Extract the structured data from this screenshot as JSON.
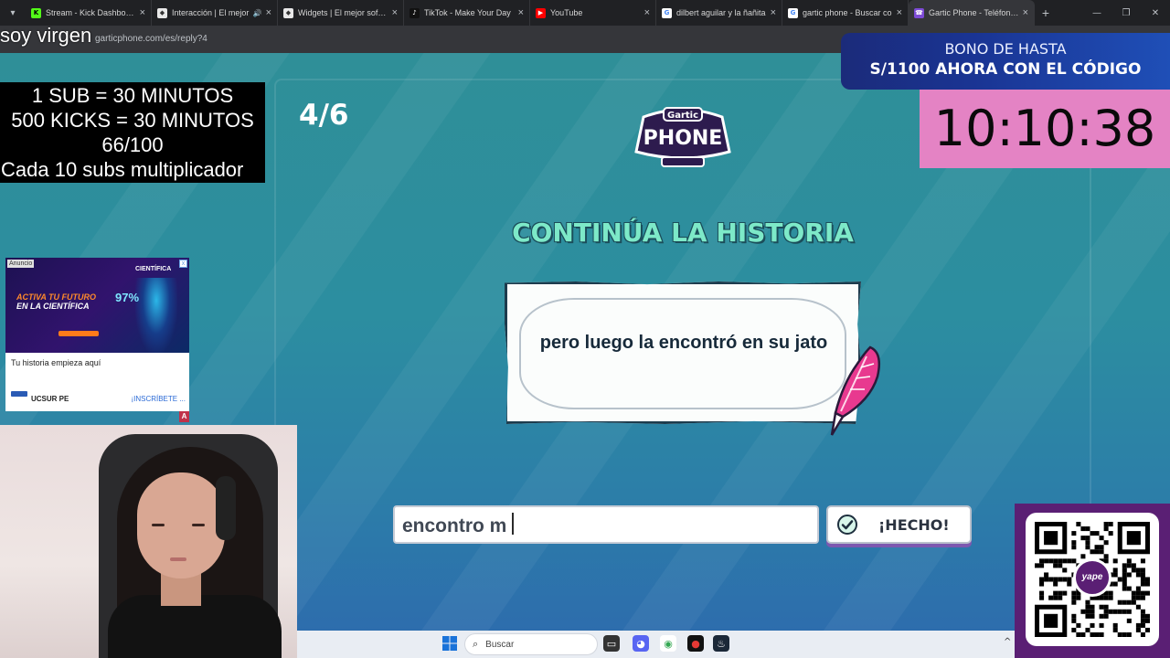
{
  "browser": {
    "tabs": [
      {
        "label": "Stream - Kick Dashboard",
        "icon": "kick-icon",
        "color": "#53fc18"
      },
      {
        "label": "Interacción | El mejor",
        "icon": "streamelements-icon",
        "color": "#e8e8e8"
      },
      {
        "label": "Widgets | El mejor softwa",
        "icon": "streamelements-icon",
        "color": "#e8e8e8"
      },
      {
        "label": "TikTok - Make Your Day",
        "icon": "tiktok-icon",
        "color": "#111111"
      },
      {
        "label": "YouTube",
        "icon": "youtube-icon",
        "color": "#ff0000"
      },
      {
        "label": "dilbert aguilar y la ñañita",
        "icon": "google-icon",
        "color": "#4285f4"
      },
      {
        "label": "gartic phone - Buscar co",
        "icon": "google-icon",
        "color": "#4285f4"
      },
      {
        "label": "Gartic Phone - Teléfono D",
        "icon": "gartic-icon",
        "color": "#7d4bd6"
      }
    ],
    "url": "garticphone.com/es/reply?4"
  },
  "stream_overlay": {
    "streamer_name": "soy virgen",
    "sub_rules": [
      "1 SUB     = 30 MINUTOS",
      "500 KICKS = 30 MINUTOS",
      "66/100",
      "Cada 10 subs multiplicador"
    ],
    "promo_line1": "BONO DE HASTA",
    "promo_line2": "S/1100 AHORA CON EL CÓDIGO",
    "timer": "10:10:38"
  },
  "ad": {
    "badge": "Anuncio",
    "brand": "CIENTÍFICA",
    "headline1": "ACTIVA TU FUTURO",
    "headline2": "EN LA CIENTÍFICA",
    "percent": "97%",
    "title": "Tu historia empieza aquí",
    "advertiser": "UCSUR PE",
    "cta": "¡INSCRÍBETE ..."
  },
  "game": {
    "round": "4/6",
    "logo_top": "Gartic",
    "logo_bottom": "PHONE",
    "headline": "CONTINÚA LA HISTORIA",
    "story_text": "pero luego la encontró en su jato",
    "input_value": "encontro m",
    "done_label": "¡HECHO!"
  },
  "qr": {
    "logo_text": "yape"
  },
  "taskbar": {
    "search_placeholder": "Buscar"
  }
}
